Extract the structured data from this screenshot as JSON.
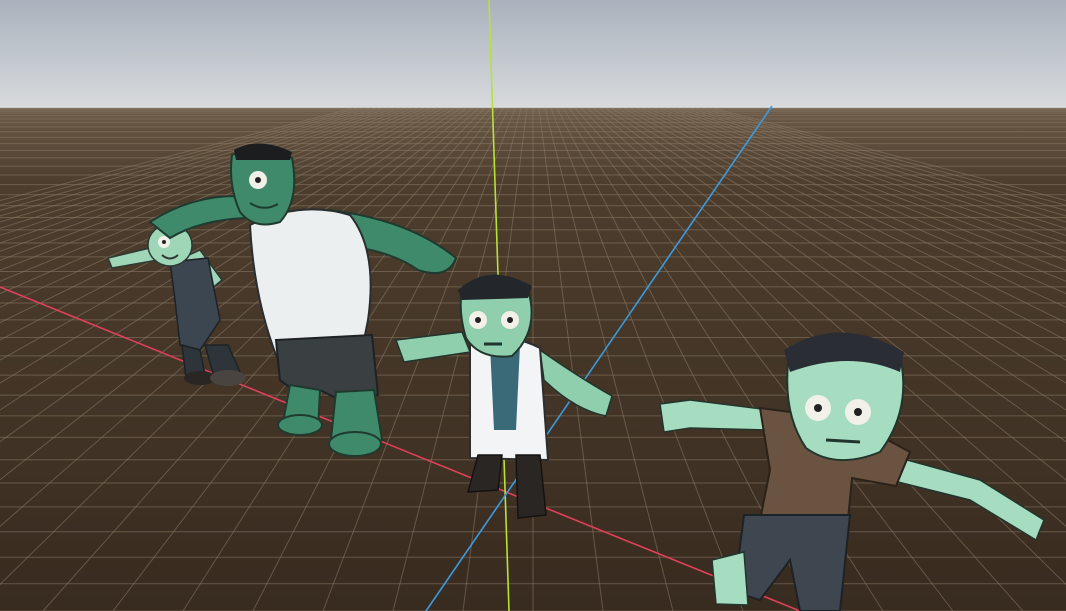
{
  "viewport": {
    "sky_top_color": "#aeb6c1",
    "sky_horizon_color": "#d6d9dc",
    "ground_near_color": "#3a2d20",
    "ground_far_color": "#5a4a38",
    "grid_line_color": "#8a7a68",
    "axis_colors": {
      "x": "#e0405a",
      "y": "#b7e23a",
      "z": "#3a9be0"
    }
  },
  "characters": [
    {
      "name": "small-zombie",
      "skin_color": "#9fd6b8",
      "outfit_color": "#3c4650",
      "icon": "zombie-icon"
    },
    {
      "name": "brute-zombie",
      "skin_color": "#3f8a6a",
      "outfit_color": "#eceff0",
      "icon": "zombie-icon"
    },
    {
      "name": "doctor-zombie",
      "skin_color": "#8fcfae",
      "outfit_color": "#f2f4f6",
      "icon": "zombie-icon"
    },
    {
      "name": "kid-zombie",
      "skin_color": "#a6dcc0",
      "outfit_color": "#6a5340",
      "icon": "zombie-icon"
    }
  ]
}
